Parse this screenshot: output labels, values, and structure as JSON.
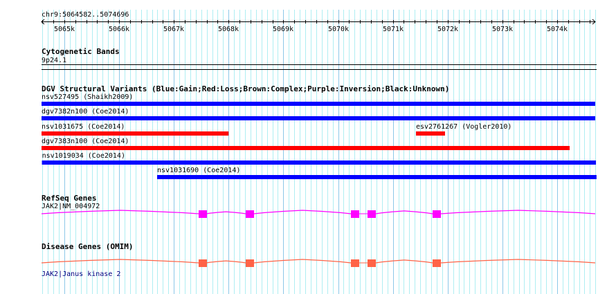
{
  "ruler": {
    "label": "chr9:5064582..5074696",
    "start": 5064582,
    "end": 5074696,
    "ticks": [
      "5065k",
      "5066k",
      "5067k",
      "5068k",
      "5069k",
      "5070k",
      "5071k",
      "5072k",
      "5073k",
      "5074k"
    ]
  },
  "cytoband": {
    "title": "Cytogenetic Bands",
    "label": "9p24.1"
  },
  "dgv": {
    "title": "DGV Structural Variants (Blue:Gain;Red:Loss;Brown:Complex;Purple:Inversion;Black:Unknown)",
    "variants": [
      {
        "label": "nsv527495 (Shaikh2009)",
        "start": 5064582,
        "end": 5074696,
        "type": "gain",
        "row": 0
      },
      {
        "label": "dgv7382n100 (Coe2014)",
        "start": 5064582,
        "end": 5074696,
        "type": "gain",
        "row": 1
      },
      {
        "label": "nsv1031675 (Coe2014)",
        "start": 5064582,
        "end": 5068000,
        "type": "loss",
        "row": 2
      },
      {
        "label": "esv2761267 (Vogler2010)",
        "start": 5071422,
        "end": 5071953,
        "type": "loss",
        "row": 2
      },
      {
        "label": "dgv7383n100 (Coe2014)",
        "start": 5064582,
        "end": 5074229,
        "type": "loss",
        "row": 3
      },
      {
        "label": "nsv1019034 (Coe2014)",
        "start": 5064590,
        "end": 5074710,
        "type": "gain",
        "row": 4
      },
      {
        "label": "nsv1031690 (Coe2014)",
        "start": 5066694,
        "end": 5074720,
        "type": "gain",
        "row": 5
      }
    ]
  },
  "refseq": {
    "title": "RefSeq Genes",
    "label": "JAK2|NM_004972",
    "color": "#ff00ff"
  },
  "omim": {
    "title": "Disease Genes (OMIM)",
    "label": "JAK2|Janus kinase 2",
    "color": "#ff6347",
    "label_color": "#000080"
  },
  "exons": [
    [
      5067453,
      5067592
    ],
    [
      5068312,
      5068464
    ],
    [
      5070234,
      5070386
    ],
    [
      5070537,
      5070689
    ],
    [
      5071726,
      5071878
    ]
  ],
  "colors": {
    "gain": "#0000ff",
    "loss": "#ff0000",
    "grid_minor": "#aeeef2",
    "grid_major": "#8cc8e8"
  }
}
